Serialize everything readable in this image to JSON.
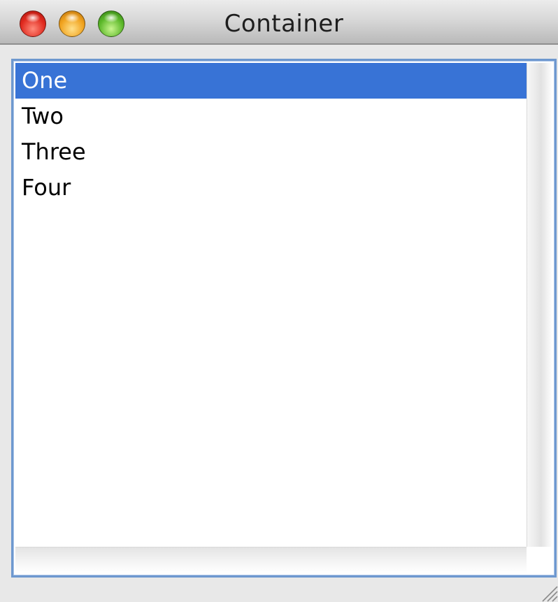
{
  "window": {
    "title": "Container"
  },
  "list": {
    "items": [
      {
        "label": "One",
        "selected": true
      },
      {
        "label": "Two",
        "selected": false
      },
      {
        "label": "Three",
        "selected": false
      },
      {
        "label": "Four",
        "selected": false
      }
    ]
  },
  "colors": {
    "selection": "#3873d6",
    "focus_ring": "#6e98cf"
  },
  "icons": {
    "close": "close-icon",
    "minimize": "minimize-icon",
    "zoom": "zoom-icon",
    "resize": "resize-grip-icon"
  }
}
